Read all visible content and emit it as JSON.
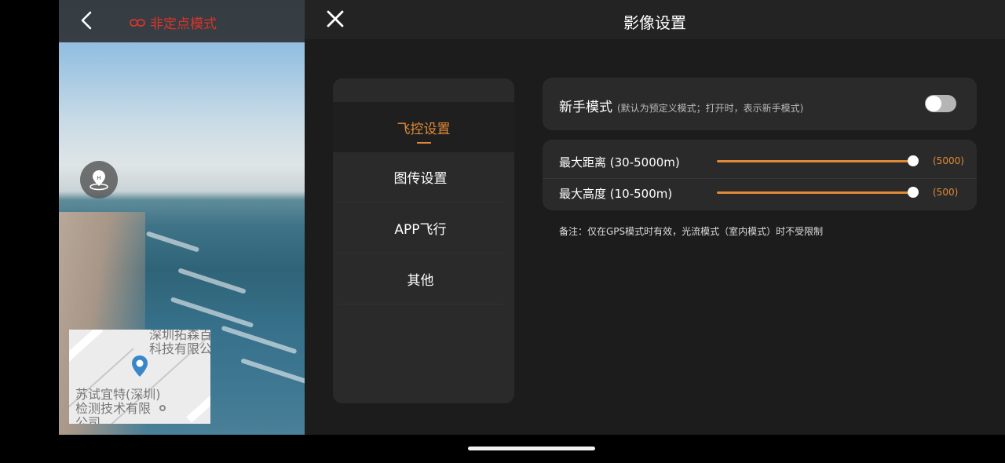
{
  "preview": {
    "mode_label": "非定点模式",
    "map": {
      "poi_top": "深圳拓森百科技有限公",
      "poi_bottom": "苏试宜特(深圳)检测技术有限公司"
    }
  },
  "panel": {
    "title": "影像设置",
    "close_glyph": "X",
    "menu": [
      {
        "label": "飞控设置",
        "active": true
      },
      {
        "label": "图传设置",
        "active": false
      },
      {
        "label": "APP飞行",
        "active": false
      },
      {
        "label": "其他",
        "active": false
      }
    ],
    "novice": {
      "label": "新手模式",
      "hint": "(默认为预定义模式；打开时，表示新手模式)",
      "enabled": false
    },
    "limits": [
      {
        "label": "最大距离 (30-5000m)",
        "value_text": "(5000)",
        "value": 5000,
        "min": 30,
        "max": 5000
      },
      {
        "label": "最大高度 (10-500m)",
        "value_text": "(500)",
        "value": 500,
        "min": 10,
        "max": 500
      }
    ],
    "note": "备注：仅在GPS模式时有效，光流模式（室内模式）时不受限制"
  },
  "colors": {
    "accent": "#e08a37",
    "mode_warning": "#d9342b"
  }
}
